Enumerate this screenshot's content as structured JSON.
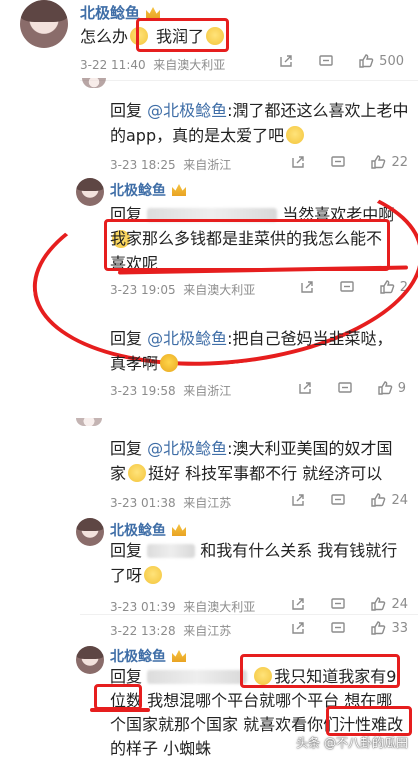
{
  "comments": [
    {
      "id": "c1",
      "name": "北极鲶鱼",
      "text_a": "怎么办",
      "text_b": "我润了",
      "date": "3-22 11:40",
      "location": "来自澳大利亚",
      "likes": "500"
    },
    {
      "id": "c2",
      "reply_label": "回复",
      "mention": "@北极鲶鱼",
      "text": ":潤了都还这么喜欢上老中的app，真的是太爱了吧",
      "date": "3-23 18:25",
      "location": "来自浙江",
      "likes": "22"
    },
    {
      "id": "c3",
      "name": "北极鲶鱼",
      "reply_label": "回复",
      "text_tail": "当然喜欢老中啊",
      "text_main": "我家那么多钱都是韭菜供的我怎么能不喜欢呢",
      "date": "3-23 19:05",
      "location": "来自澳大利亚",
      "likes": "2"
    },
    {
      "id": "c4",
      "reply_label": "回复",
      "mention": "@北极鲶鱼",
      "text": ":把自己爸妈当韭菜哒，真孝啊",
      "date": "3-23 19:58",
      "location": "来自浙江",
      "likes": "9"
    },
    {
      "id": "c5",
      "reply_label": "回复",
      "mention": "@北极鲶鱼",
      "text_a": ":澳大利亚美国的奴才国家",
      "text_b": "挺好 科技军事都不行 就经济可以",
      "date": "3-23 01:38",
      "location": "来自江苏",
      "likes": "24"
    },
    {
      "id": "c6",
      "name": "北极鲶鱼",
      "reply_label": "回复",
      "text_a": "和我有什么关系 我有钱就行了呀",
      "date": "3-23 01:39",
      "location": "来自澳大利亚",
      "likes": "24"
    },
    {
      "id": "c7",
      "date": "3-22 13:28",
      "location": "来自江苏",
      "likes": "33"
    },
    {
      "id": "c8",
      "name": "北极鲶鱼",
      "reply_label": "回复",
      "text_highlight": "我只知道我家有9",
      "text_line2a": "位数",
      "text_line2b": "我想混哪个平台就哪个平台 想在哪",
      "text_line3": "个国家就那个国家 就喜欢看你们",
      "text_line3b": "汁性难改",
      "text_line4": "的样子 小蜘蛛"
    }
  ],
  "watermark": "头条 @不八卦的瓜田",
  "colors": {
    "accent_blue": "#3f6ea7",
    "markup_red": "#e61e1e",
    "meta_gray": "#8c8c8c"
  },
  "icons": [
    "share-icon",
    "comment-icon",
    "thumbs-up-icon",
    "crown-icon",
    "avatar"
  ]
}
